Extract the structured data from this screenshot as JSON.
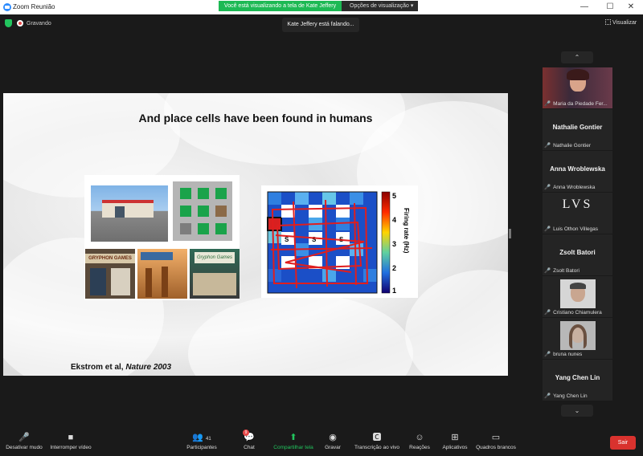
{
  "window": {
    "title": "Zoom Reunião",
    "minimize": "—",
    "maximize": "☐",
    "close": "✕"
  },
  "share_banner": {
    "text": "Você está visualizando a tela de Kate Jeffery",
    "options": "Opções de visualização ▾"
  },
  "recording": {
    "label": "Gravando"
  },
  "speaking_toast": "Kate Jeffery está falando...",
  "view_button": "Visualizar",
  "slide": {
    "title": "And place cells have been found in humans",
    "citation_authors": "Ekstrom et al, ",
    "citation_journal": "Nature 2003",
    "photo_signs": {
      "shop1": "GRYPHON GAMES",
      "sign2": "Gryphon Games"
    },
    "heatmap_ylabel": "Firing rate (Hz)",
    "colorbar_ticks": [
      "5",
      "4",
      "3",
      "2",
      "1"
    ],
    "store_labels": [
      "S",
      "S",
      "S"
    ]
  },
  "sidebar": {
    "up": "⌃",
    "down": "⌄",
    "tiles": [
      {
        "name": "",
        "label": "Maria da Piedade Fer..."
      },
      {
        "name": "Nathalie Gontier",
        "label": "Nathalie Gontier"
      },
      {
        "name": "Anna Wroblewska",
        "label": "Anna Wroblewska"
      },
      {
        "name": "LVS",
        "label": "Luis Othon Villegas"
      },
      {
        "name": "Zsolt Batori",
        "label": "Zsolt Batori"
      },
      {
        "name": "",
        "label": "Cristiano Chiamulera"
      },
      {
        "name": "",
        "label": "bruna nunes"
      },
      {
        "name": "Yang Chen Lin",
        "label": "Yang Chen Lin"
      }
    ]
  },
  "toolbar": {
    "mute": "Desativar mudo",
    "video": "Interromper vídeo",
    "participants": "Participantes",
    "participants_count": "41",
    "chat": "Chat",
    "chat_badge": "9",
    "share": "Compartilhar tela",
    "record": "Gravar",
    "transcript": "Transcrição ao vivo",
    "reactions": "Reações",
    "apps": "Aplicativos",
    "whiteboards": "Quadros brancos",
    "leave": "Sair"
  }
}
